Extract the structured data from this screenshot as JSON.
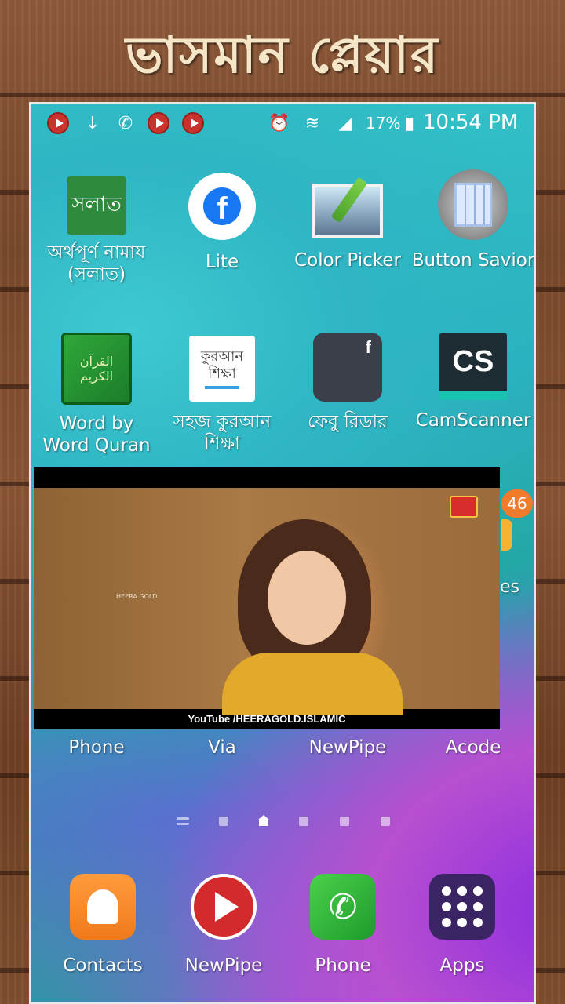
{
  "banner": {
    "title": "ভাসমান প্লেয়ার"
  },
  "status_bar": {
    "battery_percent": "17%",
    "time": "10:54 PM",
    "icons": [
      "newpipe-icon",
      "download-icon",
      "call-icon",
      "newpipe-icon",
      "newpipe-icon",
      "alarm-icon",
      "wifi-icon",
      "signal-icon",
      "battery-charging-icon"
    ]
  },
  "home_grid": {
    "row1": [
      {
        "label": "অর্থপূর্ণ নামায (সলাত)",
        "icon_text": "সলাত",
        "icon": "salat-app-icon"
      },
      {
        "label": "Lite",
        "icon_text": "f",
        "icon": "facebook-lite-icon"
      },
      {
        "label": "Color Picker",
        "icon": "color-picker-icon"
      },
      {
        "label": "Button Savior",
        "icon": "button-savior-icon"
      }
    ],
    "row2": [
      {
        "label": "Word by Word Quran",
        "icon_text": "القرآن الكريم",
        "icon": "word-quran-icon"
      },
      {
        "label": "সহজ কুরআন শিক্ষা",
        "icon_text": "কুরআন শিক্ষা",
        "icon": "quran-shikkha-icon"
      },
      {
        "label": "ফেবু রিডার",
        "icon_text": "f",
        "icon": "febu-reader-icon"
      },
      {
        "label": "CamScanner",
        "icon_text": "CS",
        "icon": "camscanner-icon"
      }
    ],
    "row3_partial": {
      "badge_count": "46",
      "peek_label": "es"
    },
    "row3_labels": [
      "Phone",
      "Via",
      "NewPipe",
      "Acode"
    ]
  },
  "floating_player": {
    "watermark": "HEERA GOLD",
    "caption": "YouTube /HEERAGOLD.ISLAMIC"
  },
  "dock": [
    {
      "label": "Contacts",
      "icon": "contacts-icon"
    },
    {
      "label": "NewPipe",
      "icon": "newpipe-icon"
    },
    {
      "label": "Phone",
      "icon": "phone-icon"
    },
    {
      "label": "Apps",
      "icon": "apps-grid-icon"
    }
  ],
  "colors": {
    "newpipe_red": "#c9332e",
    "badge_orange": "#f17a2b",
    "banner_text": "#f5e6c8"
  }
}
